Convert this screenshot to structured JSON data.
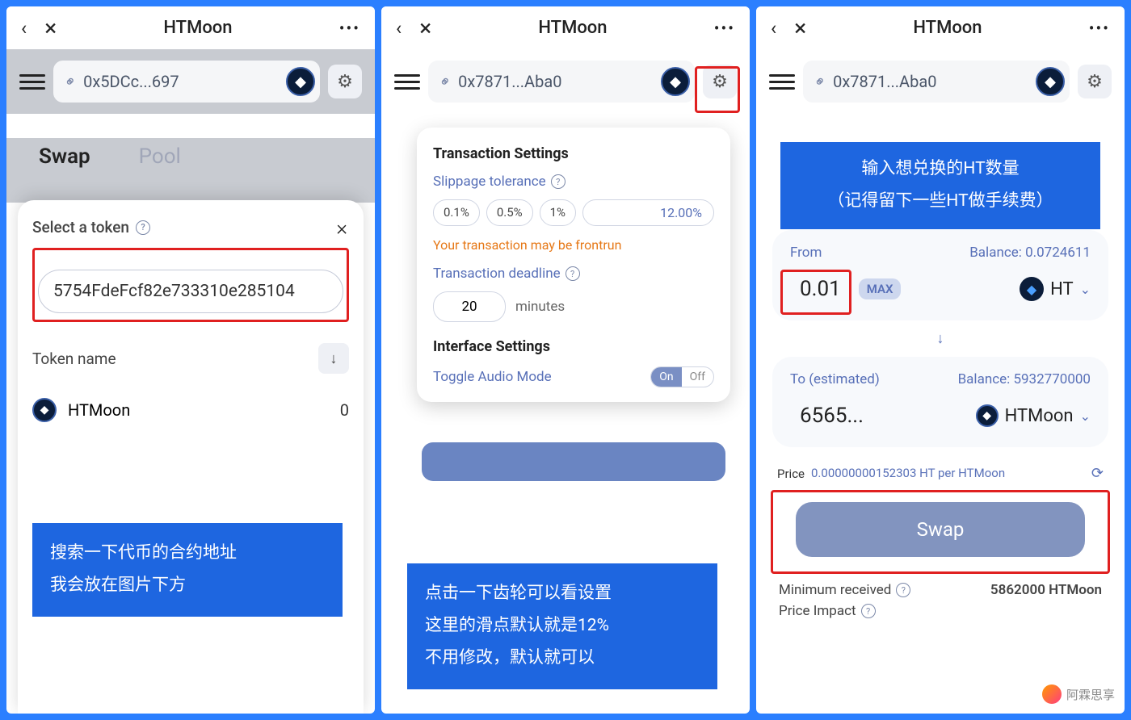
{
  "panel1": {
    "title": "HTMoon",
    "address": "0x5DCc...697",
    "tabs": {
      "swap": "Swap",
      "pool": "Pool"
    },
    "select_label": "Select a token",
    "search_value": "5754FdeFcf82e733310e285104",
    "token_name_label": "Token name",
    "token_item": {
      "symbol": "HTMoon",
      "balance": "0"
    },
    "callout_line1": "搜索一下代币的合约地址",
    "callout_line2": "我会放在图片下方"
  },
  "panel2": {
    "title": "HTMoon",
    "address": "0x7871...Aba0",
    "settings": {
      "tx_heading": "Transaction Settings",
      "slippage_label": "Slippage tolerance",
      "slippage_opts": [
        "0.1%",
        "0.5%",
        "1%"
      ],
      "slippage_value": "12.00%",
      "warn": "Your transaction may be frontrun",
      "deadline_label": "Transaction deadline",
      "deadline_value": "20",
      "deadline_unit": "minutes",
      "iface_heading": "Interface Settings",
      "audio_label": "Toggle Audio Mode",
      "toggle_on": "On",
      "toggle_off": "Off"
    },
    "callout_line1": "点击一下齿轮可以看设置",
    "callout_line2": "这里的滑点默认就是12%",
    "callout_line3": "不用修改，默认就可以"
  },
  "panel3": {
    "title": "HTMoon",
    "address": "0x7871...Aba0",
    "callout_line1": "输入想兑换的HT数量",
    "callout_line2": "（记得留下一些HT做手续费）",
    "from": {
      "label": "From",
      "balance_label": "Balance: 0.0724611",
      "amount": "0.01",
      "max": "MAX",
      "token": "HT"
    },
    "to": {
      "label": "To (estimated)",
      "balance_label": "Balance: 5932770000",
      "amount": "6565...",
      "token": "HTMoon"
    },
    "price_label": "Price",
    "price_value": "0.00000000152303 HT per HTMoon",
    "swap_btn": "Swap",
    "min_received_label": "Minimum received",
    "min_received_value": "5862000 HTMoon",
    "price_impact_label": "Price Impact",
    "watermark": "阿霖思享"
  }
}
